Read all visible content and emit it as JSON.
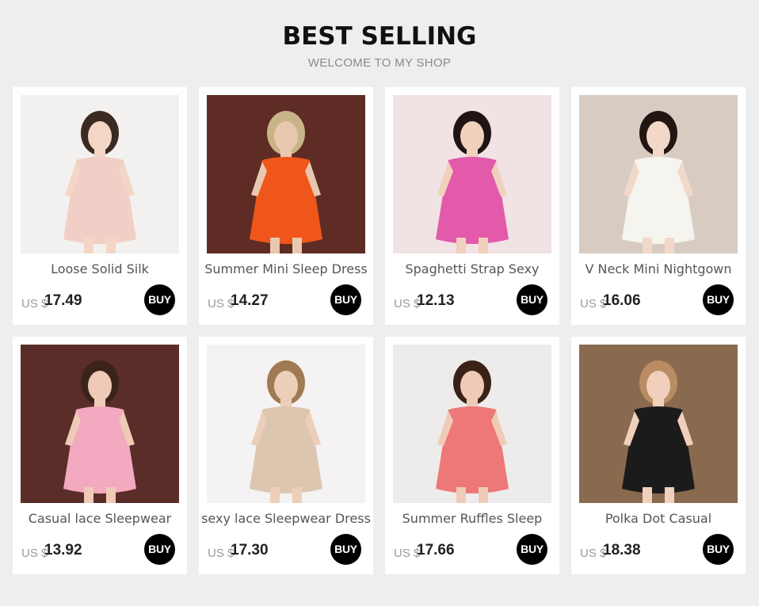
{
  "header": {
    "title": "BEST SELLING",
    "subtitle": "WELCOME TO MY SHOP"
  },
  "products": [
    {
      "name": "Loose Solid Silk",
      "currency": "US $",
      "price": "17.49",
      "buy_label": "BUY",
      "bg": "#f3f1ef",
      "dress": "#f2cfc6",
      "hair": "#3a2a22",
      "skin": "#f3d6c6"
    },
    {
      "name": "Summer Mini Sleep Dress",
      "currency": "US $",
      "price": "14.27",
      "buy_label": "BUY",
      "bg": "#5e2c24",
      "dress": "#f0561a",
      "hair": "#c9b487",
      "skin": "#e9c8b0"
    },
    {
      "name": "Spaghetti Strap Sexy",
      "currency": "US $",
      "price": "12.13",
      "buy_label": "BUY",
      "bg": "#f1e2e4",
      "dress": "#e25aa9",
      "hair": "#1f1412",
      "skin": "#f0d1bd"
    },
    {
      "name": "V Neck Mini Nightgown",
      "currency": "US $",
      "price": "16.06",
      "buy_label": "BUY",
      "bg": "#d8ccc2",
      "dress": "#f6f4ef",
      "hair": "#221612",
      "skin": "#f1d8c9"
    },
    {
      "name": "Casual lace Sleepwear",
      "currency": "US $",
      "price": "13.92",
      "buy_label": "BUY",
      "bg": "#5a2d28",
      "dress": "#f3a9c0",
      "hair": "#3b231c",
      "skin": "#efcbb7"
    },
    {
      "name": "sexy lace Sleepwear Dress",
      "currency": "US $",
      "price": "17.30",
      "buy_label": "BUY",
      "bg": "#f4f2f2",
      "dress": "#dcc6b0",
      "hair": "#a07a55",
      "skin": "#edcfb9"
    },
    {
      "name": "Summer Ruffles Sleep",
      "currency": "US $",
      "price": "17.66",
      "buy_label": "BUY",
      "bg": "#eeeceb",
      "dress": "#ee7777",
      "hair": "#3a2218",
      "skin": "#efcbb7"
    },
    {
      "name": "Polka Dot Casual",
      "currency": "US $",
      "price": "18.38",
      "buy_label": "BUY",
      "bg": "#8a6a4e",
      "dress": "#1b1b1b",
      "hair": "#b98c63",
      "skin": "#f0d0bc"
    }
  ]
}
